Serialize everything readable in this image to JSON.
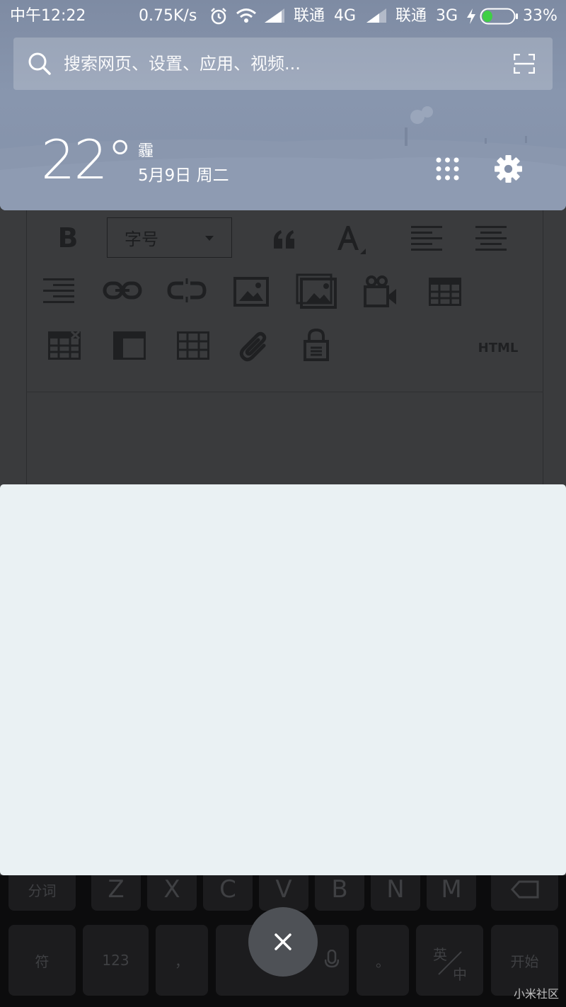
{
  "status_bar": {
    "time": "中午12:22",
    "net_speed": "0.75K/s",
    "carrier1": "联通",
    "net1": "4G",
    "carrier2": "联通",
    "net2": "3G",
    "battery": "33%",
    "battery_level": 0.33,
    "icons": [
      "alarm-icon",
      "wifi-icon",
      "signal-icon",
      "charging-icon",
      "battery-icon"
    ]
  },
  "search": {
    "placeholder": "搜索网页、设置、应用、视频..."
  },
  "weather": {
    "temperature": "22°",
    "condition": "霾",
    "date": "5月9日 周二"
  },
  "editor_toolbar": {
    "bold": "B",
    "font_size_label": "字号",
    "html_label": "HTML",
    "icons": [
      "bold-icon",
      "quote-icon",
      "font-color-icon",
      "align-left-icon",
      "align-center-icon",
      "align-right-icon",
      "link-icon",
      "unlink-icon",
      "image-icon",
      "gallery-icon",
      "video-icon",
      "table-icon",
      "delete-table-icon",
      "table-column-icon",
      "table-grid-icon",
      "attachment-icon",
      "lock-icon"
    ]
  },
  "keyboard": {
    "top_row": {
      "fenci": "分词",
      "letters": [
        "Z",
        "X",
        "C",
        "V",
        "B",
        "N",
        "M"
      ]
    },
    "bottom_row": {
      "symbols": "符",
      "numbers": "123",
      "comma": "，",
      "period": "。",
      "lang_top": "英",
      "lang_bottom": "中",
      "start": "开始"
    }
  },
  "watermark": "小米社区",
  "colors": {
    "shade": "#8491a9",
    "panel": "#eaf1f3",
    "fab": "#4e5156"
  }
}
